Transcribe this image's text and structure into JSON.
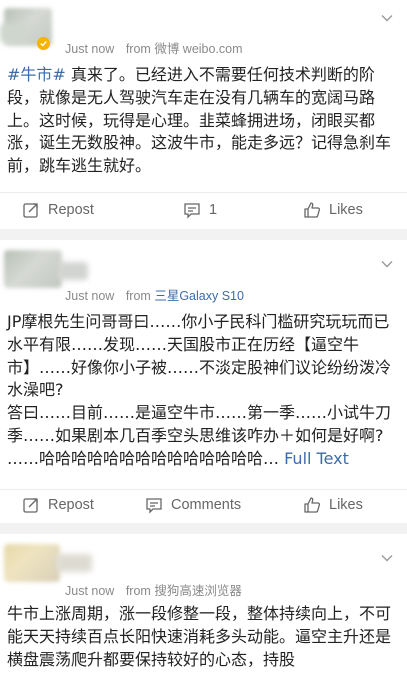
{
  "posts": [
    {
      "time": "Just now",
      "from_label": "from",
      "source": "微博 weibo.com",
      "verified_badge": true,
      "hashtag": "#牛市#",
      "text": " 真来了。已经进入不需要任何技术判断的阶段，就像是无人驾驶汽车走在没有几辆车的宽阔马路上。这时候，玩得是心理。韭菜蜂拥进场，闭眼买都涨，诞生无数股神。这波牛市，能走多远？记得急刹车前，跳车逃生就好。",
      "actions": {
        "repost": "Repost",
        "comment": "1",
        "like": "Likes"
      }
    },
    {
      "time": "Just now",
      "from_label": "from",
      "source": "三星Galaxy S10",
      "text": "JP摩根先生问哥哥曰……你小子民科门槛研究玩玩而已水平有限……发现……天国股市正在历经【逼空牛市】……好像你小子被……不淡定股神们议论纷纷泼冷水澡吧?\n答曰……目前……是逼空牛市……第一季……小试牛刀季……如果剧本几百季空头思维该咋办＋如何是好啊? ……哈哈哈哈哈哈哈哈哈哈哈哈哈哈…",
      "full_text": " Full Text",
      "actions": {
        "repost": "Repost",
        "comment": "Comments",
        "like": "Likes"
      }
    },
    {
      "time": "Just now",
      "from_label": "from",
      "source": "搜狗高速浏览器",
      "text": "牛市上涨周期，涨一段修整一段，整体持续向上，不可能天天持续百点长阳快速消耗多头动能。逼空主升还是横盘震荡爬升都要保持较好的心态，持股"
    }
  ],
  "colors": {
    "accent": "#ff8200",
    "link": "#3e6ca8",
    "text": "#222222",
    "muted": "#8a8a8a"
  },
  "icons": [
    "chevron-down-icon",
    "verified-icon",
    "repost-icon",
    "comment-icon",
    "like-icon"
  ]
}
